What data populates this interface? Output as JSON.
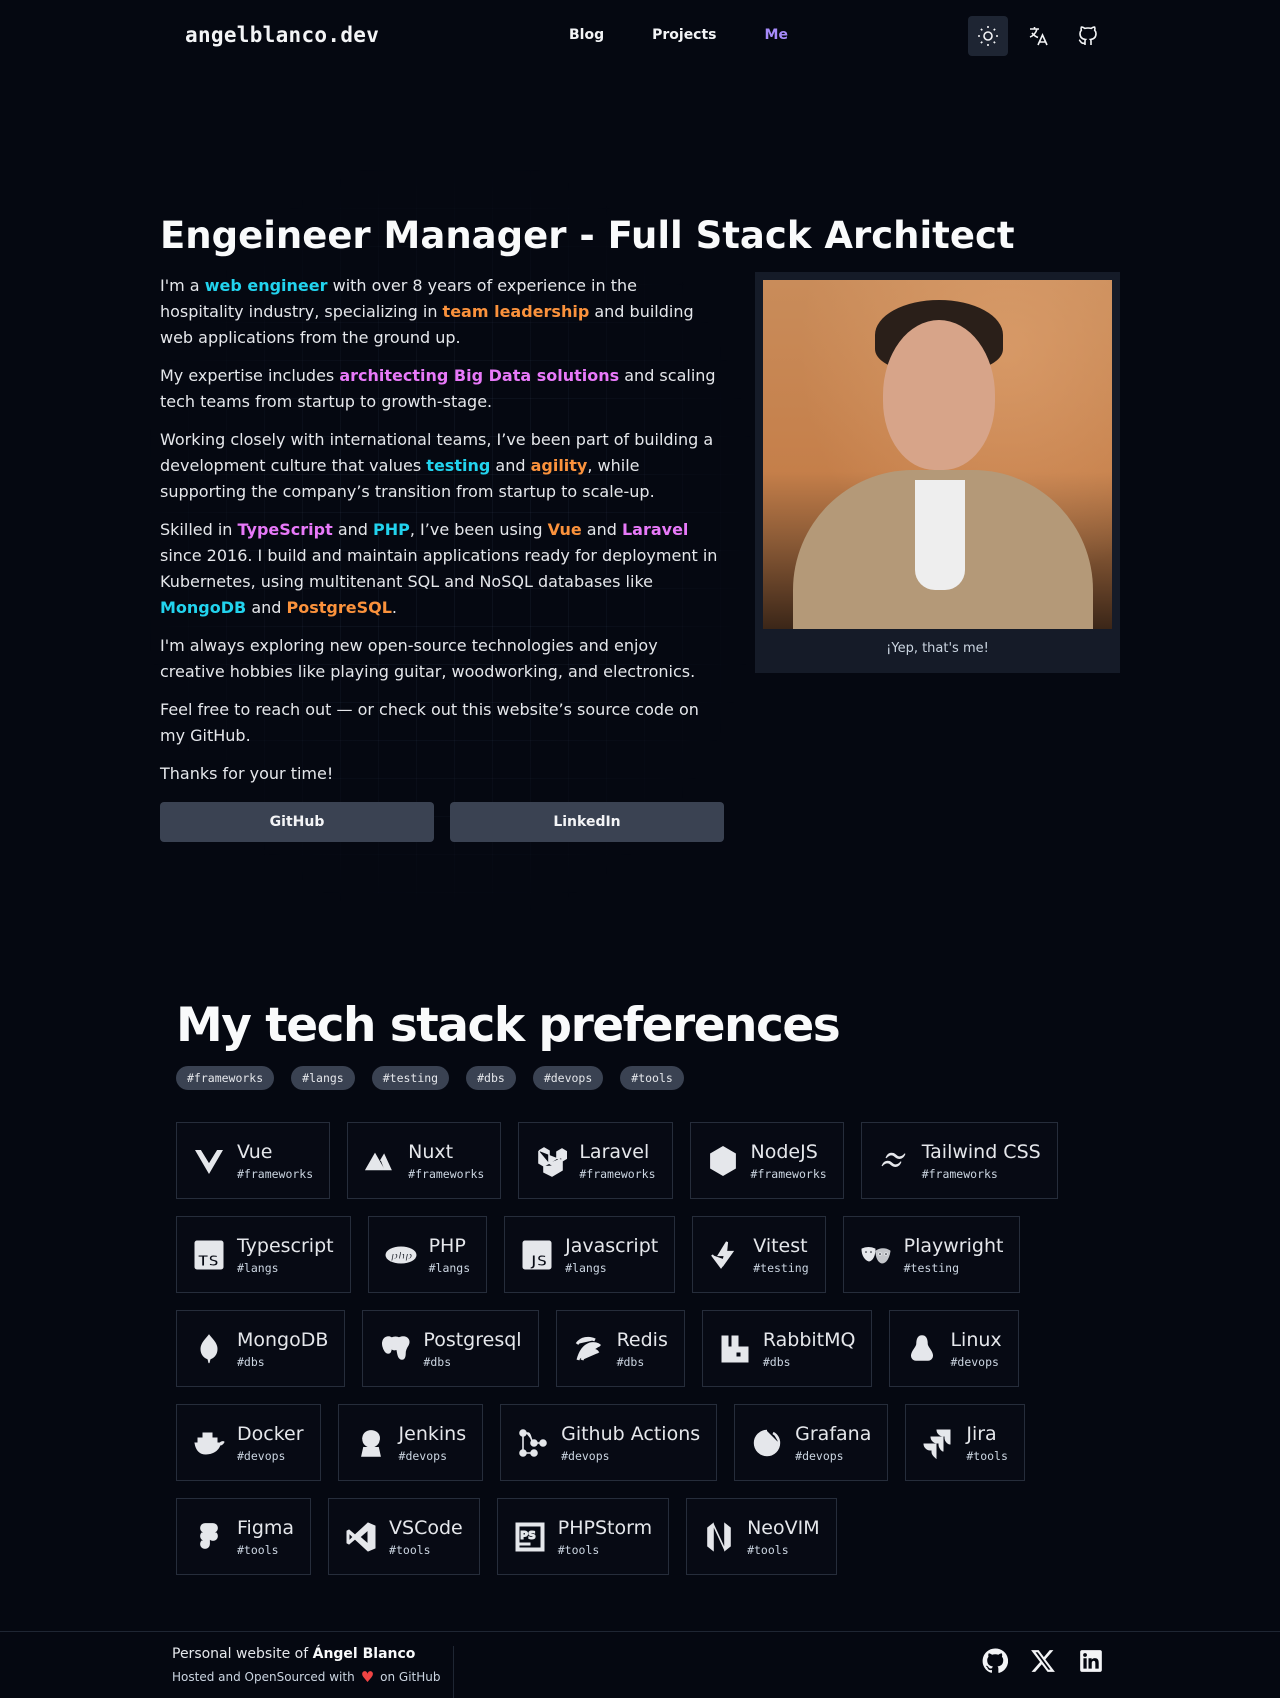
{
  "nav": {
    "logo": "angelblanco.dev",
    "links": [
      {
        "label": "Blog",
        "active": false
      },
      {
        "label": "Projects",
        "active": false
      },
      {
        "label": "Me",
        "active": true
      }
    ],
    "icons": [
      "sun-icon",
      "translate-icon",
      "github-icon"
    ]
  },
  "hero": {
    "title": "Engeineer Manager - Full Stack Architect",
    "p1": {
      "a": "I'm a ",
      "b": "web engineer",
      "c": " with over 8 years of experience in the hospitality industry, specializing in ",
      "d": "team leadership",
      "e": " and building web applications from the ground up."
    },
    "p2": {
      "a": "My expertise includes ",
      "b": "architecting Big Data solutions",
      "c": " and scaling tech teams from startup to growth-stage."
    },
    "p3": {
      "a": "Working closely with international teams, I’ve been part of building a development culture that values ",
      "b": "testing",
      "c": " and ",
      "d": "agility",
      "e": ", while supporting the company’s transition from startup to scale-up."
    },
    "p4": {
      "a": "Skilled in ",
      "b": "TypeScript",
      "c": " and ",
      "d": "PHP",
      "e": ", I’ve been using ",
      "f": "Vue",
      "g": " and ",
      "h": "Laravel",
      "i": " since 2016. I build and maintain applications ready for deployment in Kubernetes, using multitenant SQL and NoSQL databases like ",
      "j": "MongoDB",
      "k": " and ",
      "l": "PostgreSQL",
      "m": "."
    },
    "p5": "I'm always exploring new open-source technologies and enjoy creative hobbies like playing guitar, woodworking, and electronics.",
    "p6": "Feel free to reach out — or check out this website’s source code on my GitHub.",
    "p7": "Thanks for your time!",
    "buttons": {
      "github": "GitHub",
      "linkedin": "LinkedIn"
    },
    "photo_caption": "¡Yep, that's me!"
  },
  "stack": {
    "title": "My tech stack preferences",
    "tags": [
      "#frameworks",
      "#langs",
      "#testing",
      "#dbs",
      "#devops",
      "#tools"
    ],
    "rows": [
      [
        {
          "name": "Vue",
          "tag": "#frameworks",
          "icon": "vue-icon"
        },
        {
          "name": "Nuxt",
          "tag": "#frameworks",
          "icon": "nuxt-icon"
        },
        {
          "name": "Laravel",
          "tag": "#frameworks",
          "icon": "laravel-icon"
        },
        {
          "name": "NodeJS",
          "tag": "#frameworks",
          "icon": "nodejs-icon"
        },
        {
          "name": "Tailwind CSS",
          "tag": "#frameworks",
          "icon": "tailwind-icon"
        }
      ],
      [
        {
          "name": "Typescript",
          "tag": "#langs",
          "icon": "typescript-icon"
        },
        {
          "name": "PHP",
          "tag": "#langs",
          "icon": "php-icon"
        },
        {
          "name": "Javascript",
          "tag": "#langs",
          "icon": "javascript-icon"
        },
        {
          "name": "Vitest",
          "tag": "#testing",
          "icon": "vitest-icon"
        },
        {
          "name": "Playwright",
          "tag": "#testing",
          "icon": "playwright-icon"
        }
      ],
      [
        {
          "name": "MongoDB",
          "tag": "#dbs",
          "icon": "mongodb-icon"
        },
        {
          "name": "Postgresql",
          "tag": "#dbs",
          "icon": "postgresql-icon"
        },
        {
          "name": "Redis",
          "tag": "#dbs",
          "icon": "redis-icon"
        },
        {
          "name": "RabbitMQ",
          "tag": "#dbs",
          "icon": "rabbitmq-icon"
        },
        {
          "name": "Linux",
          "tag": "#devops",
          "icon": "linux-icon"
        }
      ],
      [
        {
          "name": "Docker",
          "tag": "#devops",
          "icon": "docker-icon"
        },
        {
          "name": "Jenkins",
          "tag": "#devops",
          "icon": "jenkins-icon"
        },
        {
          "name": "Github Actions",
          "tag": "#devops",
          "icon": "github-actions-icon"
        },
        {
          "name": "Grafana",
          "tag": "#devops",
          "icon": "grafana-icon"
        },
        {
          "name": "Jira",
          "tag": "#tools",
          "icon": "jira-icon"
        }
      ],
      [
        {
          "name": "Figma",
          "tag": "#tools",
          "icon": "figma-icon"
        },
        {
          "name": "VSCode",
          "tag": "#tools",
          "icon": "vscode-icon"
        },
        {
          "name": "PHPStorm",
          "tag": "#tools",
          "icon": "phpstorm-icon"
        },
        {
          "name": "NeoVIM",
          "tag": "#tools",
          "icon": "neovim-icon"
        }
      ]
    ]
  },
  "footer": {
    "line1_prefix": "Personal website of ",
    "line1_name": "Ángel Blanco",
    "line2_prefix": "Hosted and OpenSourced with",
    "line2_suffix": "on GitHub",
    "icons": [
      "github-icon",
      "x-icon",
      "linkedin-icon"
    ]
  },
  "colors": {
    "background": "#050811",
    "accent_purple": "#a78bfa",
    "highlight_cyan": "#22d3ee",
    "highlight_orange": "#fb923c",
    "highlight_pink": "#e879f9",
    "button_bg": "#3a4252"
  }
}
